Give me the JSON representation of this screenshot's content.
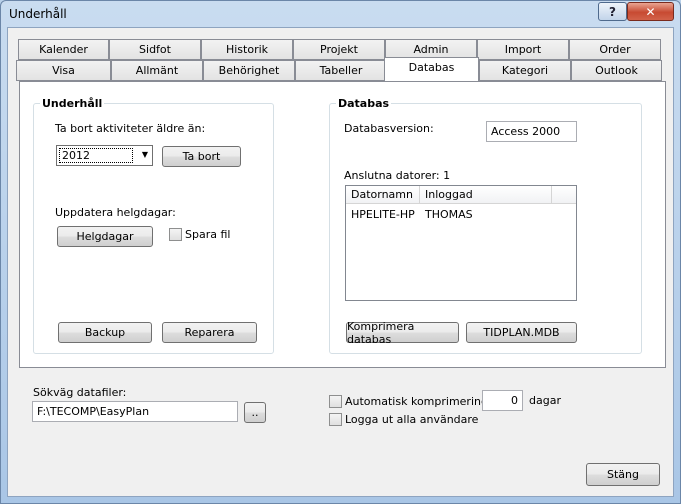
{
  "window": {
    "title": "Underhåll",
    "help_glyph": "?",
    "close_glyph": "✕"
  },
  "tabs_row1": [
    "Kalender",
    "Sidfot",
    "Historik",
    "Projekt",
    "Admin",
    "Import",
    "Order"
  ],
  "tabs_row2": [
    "Visa",
    "Allmänt",
    "Behörighet",
    "Tabeller",
    "Databas",
    "Kategori",
    "Outlook"
  ],
  "active_tab": "Databas",
  "maintenance": {
    "group_label": "Underhåll",
    "delete_label": "Ta bort aktiviteter äldre än:",
    "year_value": "2012",
    "delete_button": "Ta bort",
    "update_holidays_label": "Uppdatera helgdagar:",
    "holidays_button": "Helgdagar",
    "save_file_label": "Spara fil",
    "backup_button": "Backup",
    "repair_button": "Reparera"
  },
  "database": {
    "group_label": "Databas",
    "version_label": "Databasversion:",
    "version_value": "Access 2000",
    "connected_label": "Anslutna datorer: 1",
    "columns": [
      "Datornamn",
      "Inloggad"
    ],
    "rows": [
      {
        "computer": "HPELITE-HP",
        "user": "THOMAS"
      }
    ],
    "compact_button": "Komprimera databas",
    "file_button": "TIDPLAN.MDB"
  },
  "datafiles": {
    "label": "Sökväg datafiler:",
    "path_value": "F:\\TECOMP\\EasyPlan",
    "browse_button": ".."
  },
  "options": {
    "auto_compact_label": "Automatisk komprimering",
    "days_value": "0",
    "days_label": "dagar",
    "logout_label": "Logga ut alla användare"
  },
  "close_button": "Stäng"
}
